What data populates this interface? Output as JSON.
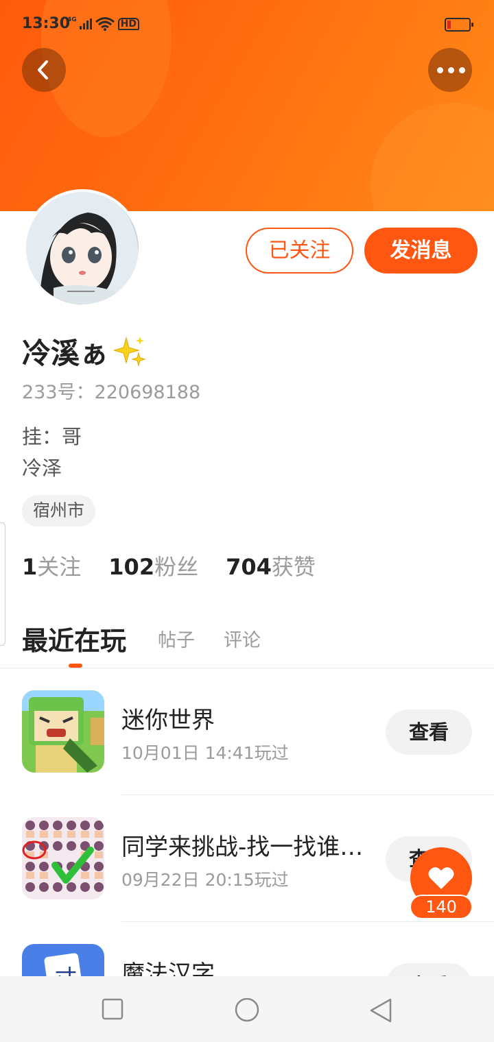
{
  "status_bar": {
    "time": "13:30",
    "network": "4G",
    "hd_label": "HD",
    "battery_color": "#d42b1a"
  },
  "header": {
    "back_icon": "chevron-left-icon",
    "more_icon": "more-dots-icon",
    "banner_color": "#ff6a10"
  },
  "profile": {
    "name": "冷溪ぁ",
    "id_line": "233号：220698188",
    "bio_lines": [
      "挂：哥",
      "冷泽"
    ],
    "location": "宿州市",
    "follow_button": "已关注",
    "message_button": "发消息"
  },
  "stats": [
    {
      "value": "1",
      "label": "关注"
    },
    {
      "value": "102",
      "label": "粉丝"
    },
    {
      "value": "704",
      "label": "获赞"
    }
  ],
  "tabs": [
    "最近在玩",
    "帖子",
    "评论"
  ],
  "active_tab": 0,
  "games": [
    {
      "name": "迷你世界",
      "played": "10月01日 14:41玩过",
      "button": "查看"
    },
    {
      "name": "同学来挑战-找一找谁…",
      "played": "09月22日 20:15玩过",
      "button": "查看"
    },
    {
      "name": "魔法汉字",
      "played": "",
      "button": "查看"
    }
  ],
  "like_fab": {
    "count": "140",
    "icon": "heart-icon"
  },
  "nav_bar": {
    "icons": [
      "recent-apps-icon",
      "home-icon",
      "back-triangle-icon"
    ]
  },
  "accent_color": "#ff5611"
}
